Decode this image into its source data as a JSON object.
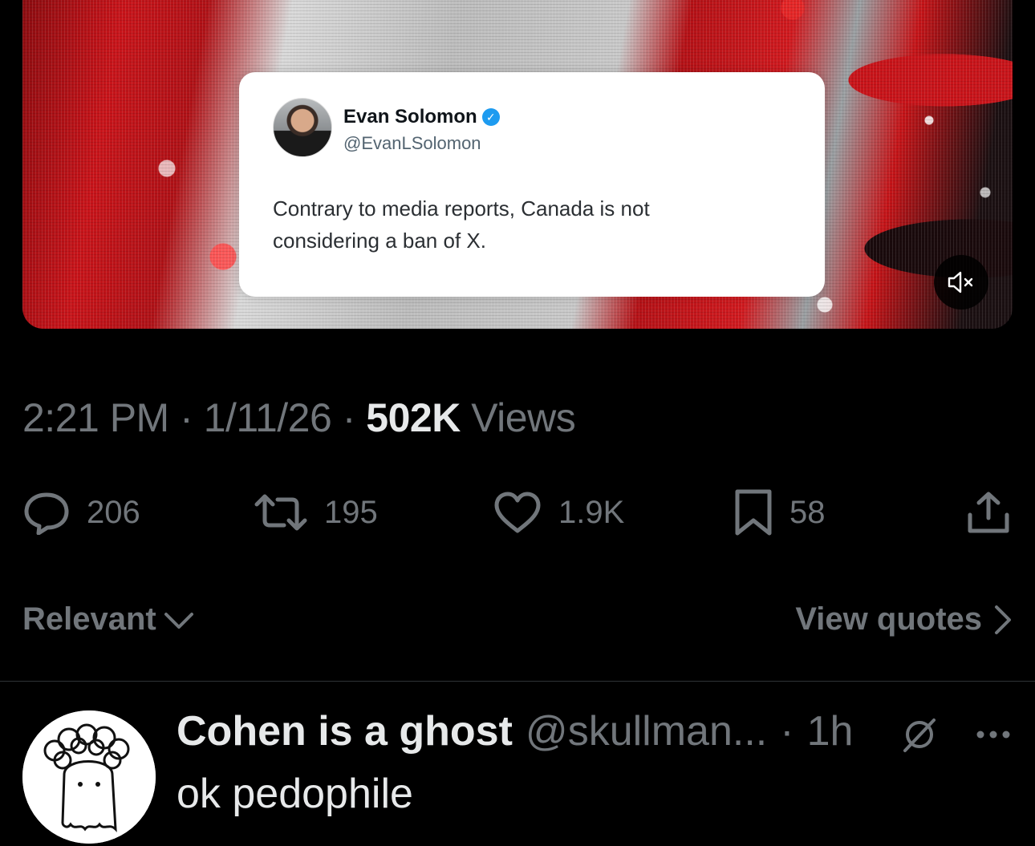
{
  "media": {
    "quote_card": {
      "name": "Evan Solomon",
      "handle": "@EvanLSolomon",
      "text": "Contrary to media reports, Canada is not considering a ban of X."
    },
    "mute_icon": "speaker-muted-icon"
  },
  "meta": {
    "time": "2:21 PM",
    "date": "1/11/26",
    "views_count": "502K",
    "views_label": "Views",
    "separator": "·"
  },
  "actions": {
    "replies": "206",
    "reposts": "195",
    "likes": "1.9K",
    "bookmarks": "58"
  },
  "sort": {
    "label": "Relevant",
    "view_quotes": "View quotes"
  },
  "reply": {
    "name": "Cohen is a ghost",
    "handle": "@skullman...",
    "time": "1h",
    "separator": "·",
    "text": "ok pedophile"
  },
  "colors": {
    "background": "#000000",
    "muted_text": "#71767b",
    "primary_text": "#e7e9ea",
    "verified": "#1d9bf0",
    "divider": "#2f3336"
  }
}
